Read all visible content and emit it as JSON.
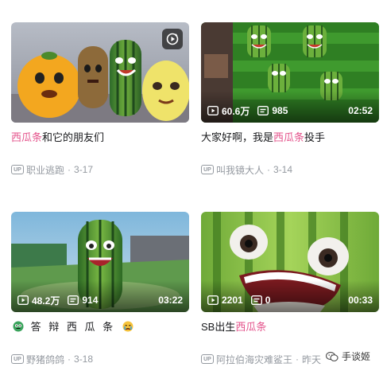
{
  "cards": [
    {
      "title_hl": "西瓜条",
      "title_rest": "和它的朋友们",
      "uploader": "职业逃跑",
      "date": "3-17",
      "has_replay": true,
      "thumb_icon": "replay-icon"
    },
    {
      "views": "60.6万",
      "danmaku": "985",
      "duration": "02:52",
      "title_pre": "大家好啊，我是",
      "title_hl": "西瓜条",
      "title_post": "投手",
      "uploader": "叫我镜大人",
      "date": "3-14"
    },
    {
      "views": "48.2万",
      "danmaku": "914",
      "duration": "03:22",
      "title_text": "答 辩 西 瓜 条",
      "uploader": "野猪鸽鸽",
      "date": "3-18",
      "emoji_left": "green-face-emoji-icon",
      "emoji_right": "crying-face-emoji-icon"
    },
    {
      "views": "2201",
      "danmaku": "0",
      "duration": "00:33",
      "title_pre": "SB出生",
      "title_hl": "西瓜条",
      "uploader": "阿拉伯海灾难鲨王",
      "date": "昨天"
    }
  ],
  "labels": {
    "up_badge": "UP",
    "separator": "·"
  },
  "watermark": {
    "text": "手谈姬",
    "icon": "wechat-icon"
  },
  "colors": {
    "highlight": "#e4548c",
    "meta": "#9499a0",
    "text": "#18191c"
  }
}
